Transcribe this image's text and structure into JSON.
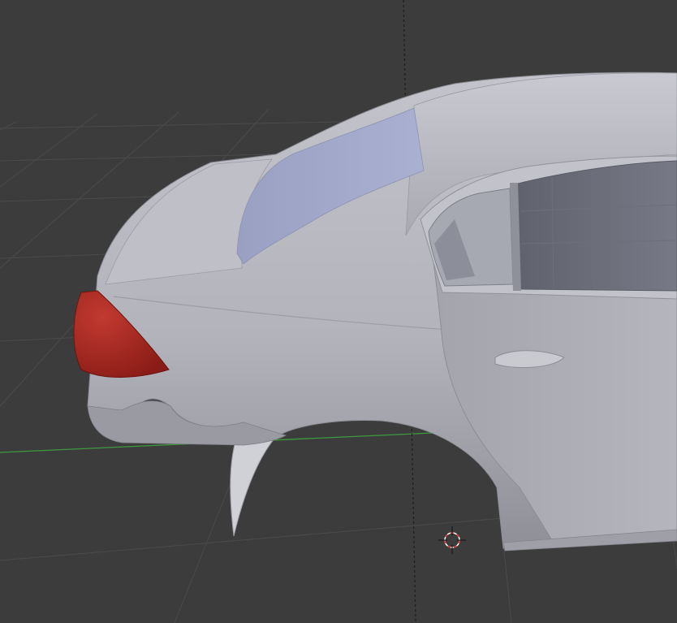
{
  "viewport": {
    "background_color": "#3c3c3c",
    "grid_line_color": "#4a4a4a",
    "x_axis_color": "#3f9a3f",
    "y_axis_color": "#1f1f1f",
    "view_mode": "solid-shading"
  },
  "scene": {
    "model": "car-body-rear-quarter",
    "body_color": "#b4b5bd",
    "window_color": "#9ea4c4",
    "taillight_color": "#a6261f",
    "interior_color": "#6a6c78"
  },
  "cursor": {
    "icon": "3d-cursor-icon",
    "ring_colors": [
      "#e23a3a",
      "#ffffff"
    ]
  }
}
